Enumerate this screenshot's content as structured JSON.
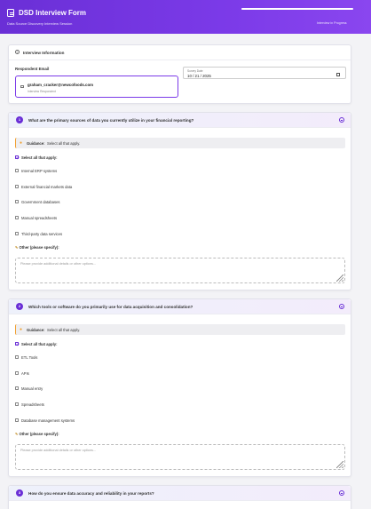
{
  "header": {
    "title": "DSD Interview Form",
    "subtitle": "Data Source Discovery Interview Session",
    "status": "Interview in Progress"
  },
  "interview_info": {
    "section_title": "Interview Information",
    "email_label": "Respondent Email",
    "email_value": "graham_cracker@newcofoods.com",
    "email_sub": "Interview Respondent",
    "date_label": "Survey Date",
    "date_value": "10 / 21 / 2025"
  },
  "questions": [
    {
      "number": "1",
      "text": "What are the primary sources of data you currently utilize in your financial reporting?",
      "guidance_label": "Guidance:",
      "guidance_text": "Select all that apply.",
      "select_all": "Select all that apply:",
      "options": [
        "Internal ERP systems",
        "External financial markets data",
        "Government databases",
        "Manual spreadsheets",
        "Third-party data services"
      ],
      "other_label": "Other (please specify):",
      "placeholder": "Please provide additional details or other options..."
    },
    {
      "number": "2",
      "text": "Which tools or software do you primarily use for data acquisition and consolidation?",
      "guidance_label": "Guidance:",
      "guidance_text": "Select all that apply.",
      "select_all": "Select all that apply:",
      "options": [
        "ETL Tools",
        "APIs",
        "Manual entry",
        "Spreadsheets",
        "Database management systems"
      ],
      "other_label": "Other (please specify):",
      "placeholder": "Please provide additional details or other options..."
    },
    {
      "number": "3",
      "text": "How do you ensure data accuracy and reliability in your reports?"
    }
  ]
}
